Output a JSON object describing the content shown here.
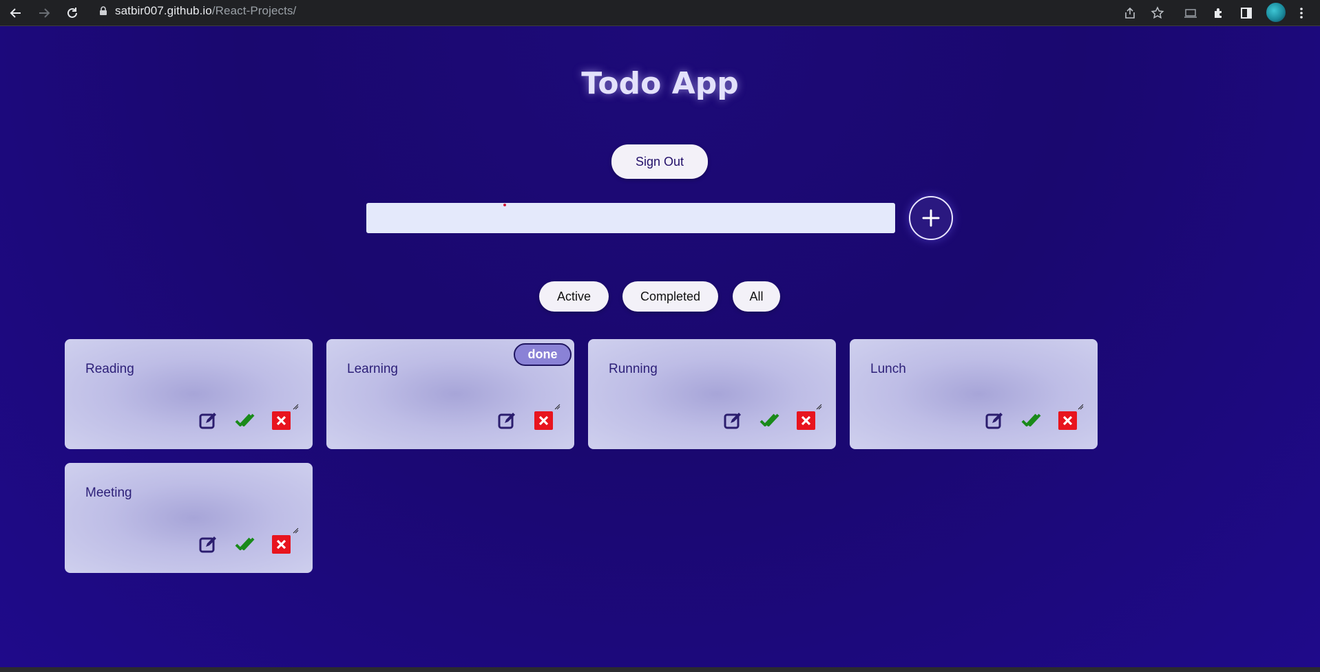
{
  "browser": {
    "url_host": "satbir007.github.io",
    "url_path": "/React-Projects/"
  },
  "app": {
    "title": "Todo App",
    "sign_out_label": "Sign Out",
    "input_value": "",
    "add_icon": "plus-icon"
  },
  "filters": [
    {
      "label": "Active"
    },
    {
      "label": "Completed"
    },
    {
      "label": "All"
    }
  ],
  "todos": [
    {
      "title": "Reading",
      "done": false
    },
    {
      "title": "Learning",
      "done": true,
      "badge": "done"
    },
    {
      "title": "Running",
      "done": false
    },
    {
      "title": "Lunch",
      "done": false
    },
    {
      "title": "Meeting",
      "done": false
    }
  ],
  "colors": {
    "page_background": "#1a0878",
    "card_background": "#c4c4e8",
    "edit_icon": "#2b1d6e",
    "check_icon": "#1a8a1a",
    "delete_icon": "#e8141e",
    "badge_background": "#8a82d6"
  }
}
